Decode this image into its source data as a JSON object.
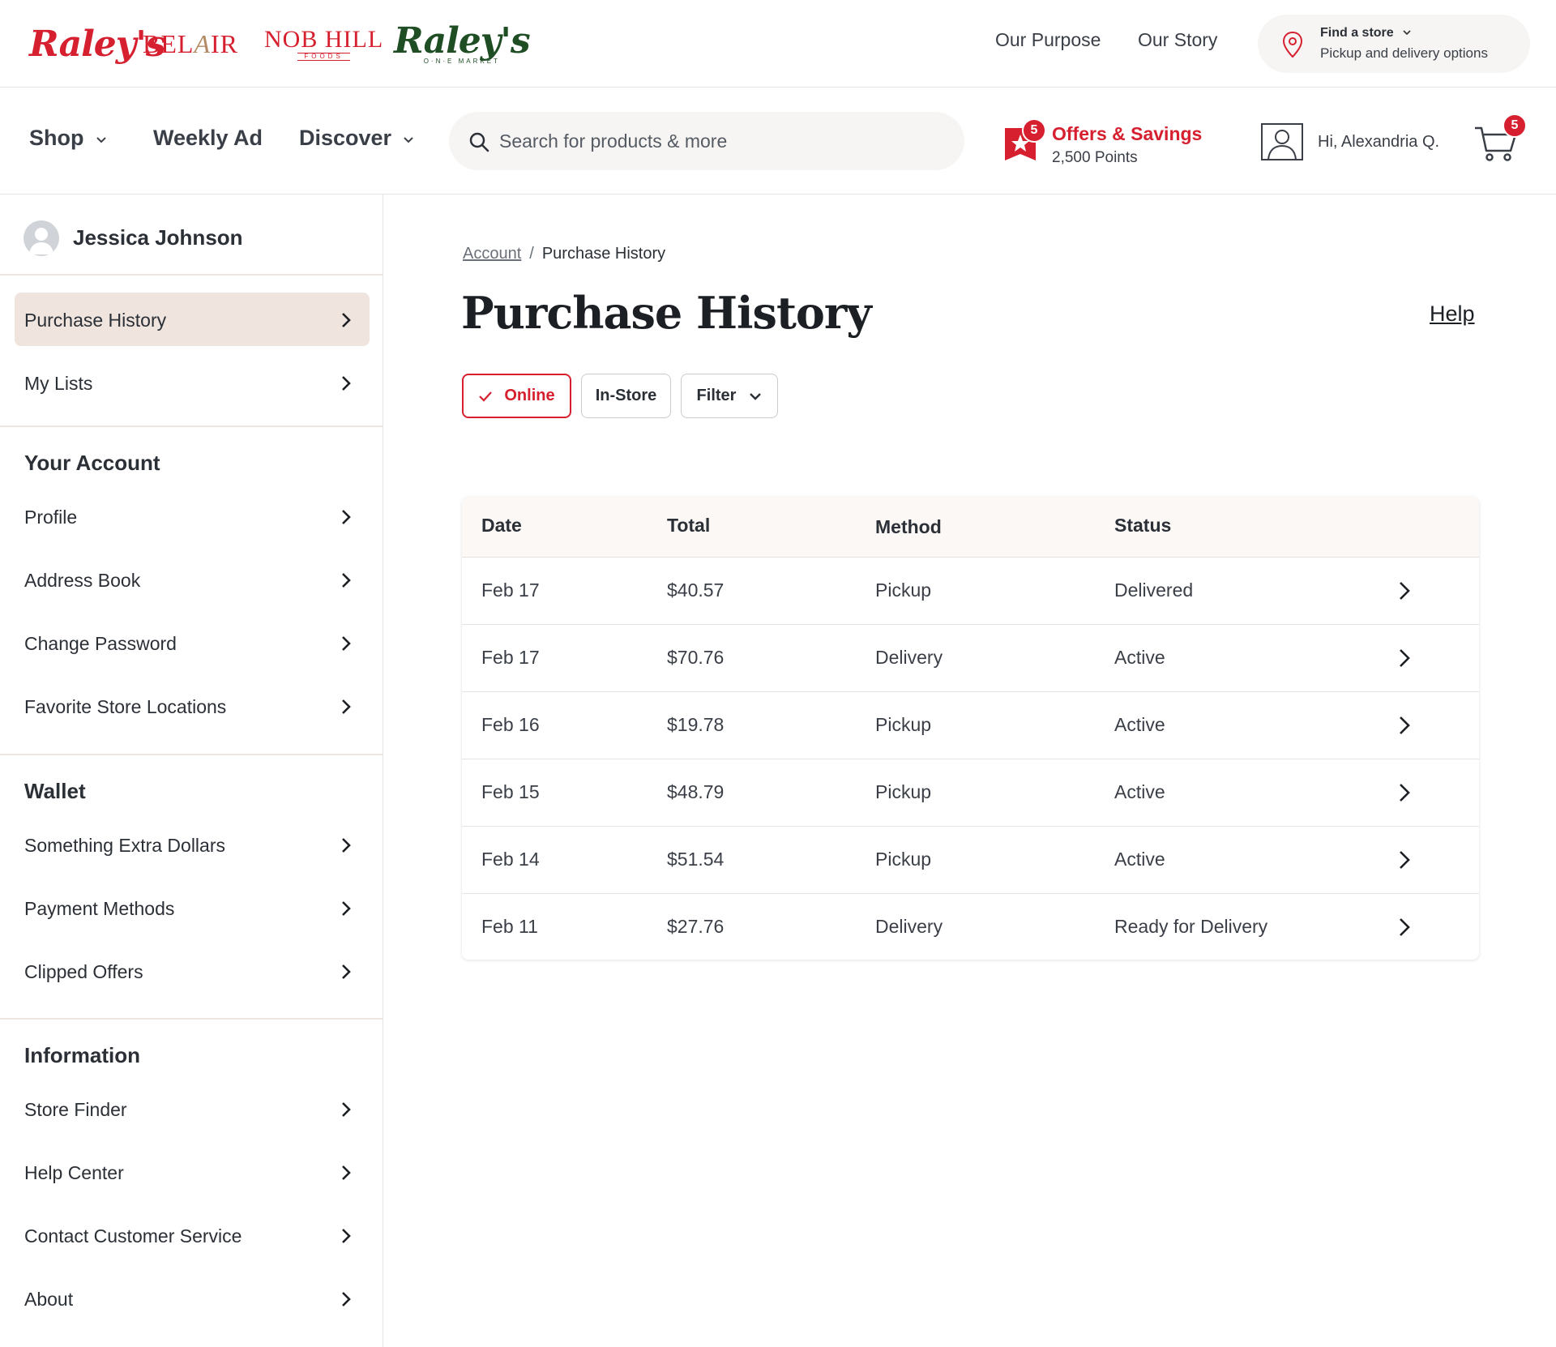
{
  "header": {
    "brands": {
      "raleys": "Raley's",
      "belair_a": "BEL",
      "belair_b": "A",
      "belair_c": "IR",
      "nobhill": "NOB HILL",
      "nobhill_sub": "FOODS",
      "one_market": "Raley's",
      "one_market_sub": "O·N·E MARKET"
    },
    "links": {
      "purpose": "Our Purpose",
      "story": "Our Story"
    },
    "store": {
      "title": "Find a store",
      "subtitle": "Pickup and delivery options"
    }
  },
  "nav": {
    "shop": "Shop",
    "weekly_ad": "Weekly Ad",
    "discover": "Discover",
    "search_placeholder": "Search for products & more",
    "offers": {
      "badge": "5",
      "title": "Offers & Savings",
      "points": "2,500 Points"
    },
    "user_greeting": "Hi, Alexandria Q.",
    "cart_badge": "5"
  },
  "sidebar": {
    "profile_name": "Jessica Johnson",
    "top_items": [
      "Purchase History",
      "My Lists"
    ],
    "sections": [
      {
        "title": "Your Account",
        "items": [
          "Profile",
          "Address Book",
          "Change Password",
          "Favorite Store Locations"
        ]
      },
      {
        "title": "Wallet",
        "items": [
          "Something Extra Dollars",
          "Payment Methods",
          "Clipped Offers"
        ]
      },
      {
        "title": "Information",
        "items": [
          "Store Finder",
          "Help Center",
          "Contact Customer Service",
          "About"
        ]
      }
    ]
  },
  "main": {
    "breadcrumb": {
      "parent": "Account",
      "separator": "/",
      "current": "Purchase History"
    },
    "title": "Purchase History",
    "help": "Help",
    "filters": {
      "online": "Online",
      "instore": "In-Store",
      "filter": "Filter"
    },
    "table": {
      "headers": {
        "date": "Date",
        "total": "Total",
        "method": "Method",
        "status": "Status"
      },
      "rows": [
        {
          "date": "Feb 17",
          "total": "$40.57",
          "method": "Pickup",
          "status": "Delivered"
        },
        {
          "date": "Feb 17",
          "total": "$70.76",
          "method": "Delivery",
          "status": "Active"
        },
        {
          "date": "Feb 16",
          "total": "$19.78",
          "method": "Pickup",
          "status": "Active"
        },
        {
          "date": "Feb 15",
          "total": "$48.79",
          "method": "Pickup",
          "status": "Active"
        },
        {
          "date": "Feb 14",
          "total": "$51.54",
          "method": "Pickup",
          "status": "Active"
        },
        {
          "date": "Feb 11",
          "total": "$27.76",
          "method": "Delivery",
          "status": "Ready for Delivery"
        }
      ]
    }
  },
  "colors": {
    "brand_red": "#d6202f",
    "active_item_bg": "#efe4de",
    "one_market_green": "#1f4d24"
  }
}
